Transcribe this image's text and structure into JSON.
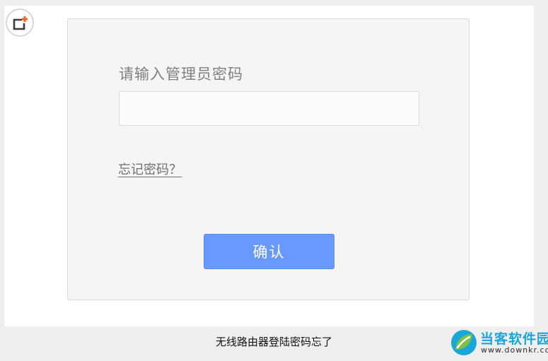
{
  "login": {
    "prompt": "请输入管理员密码",
    "password_value": "",
    "forgot_link": "忘记密码？",
    "confirm_label": "确认"
  },
  "caption": "无线路由器登陆密码忘了",
  "watermark": {
    "name": "当客软件园",
    "url": "www.downkr.com"
  },
  "icons": {
    "corner_badge": "add-frame-icon",
    "watermark_logo": "leaf-logo"
  },
  "colors": {
    "accent": "#6899ff",
    "badge_orange": "#f26522",
    "watermark_blue": "#19a6d8",
    "watermark_green": "#7cc242"
  }
}
